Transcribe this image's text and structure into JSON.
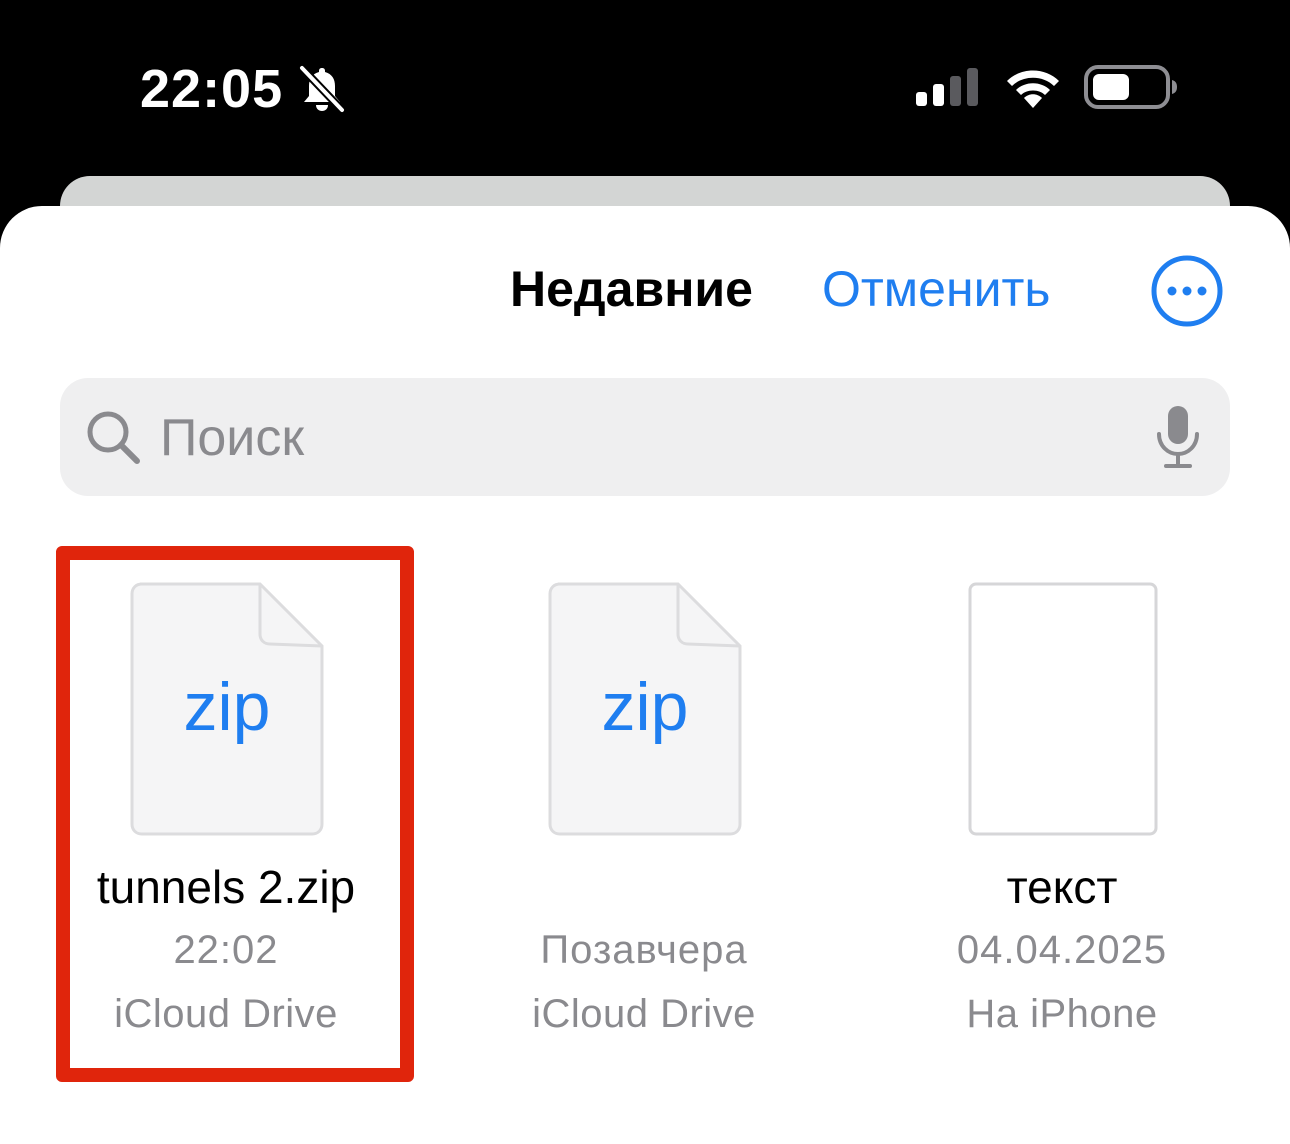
{
  "status_bar": {
    "time": "22:05",
    "icons": [
      "bell-slash-icon",
      "cellular-signal-icon",
      "wifi-icon",
      "battery-icon"
    ]
  },
  "header": {
    "title": "Недавние",
    "cancel_label": "Отменить",
    "more_icon": "ellipsis-circle-icon"
  },
  "search": {
    "placeholder": "Поиск",
    "value": "",
    "search_icon": "magnifying-glass-icon",
    "mic_icon": "microphone-icon"
  },
  "files": [
    {
      "name": "tunnels 2.zip",
      "date": "22:02",
      "location": "iCloud Drive",
      "thumbnail_label": "zip",
      "highlighted": true
    },
    {
      "name": "",
      "date": "Позавчера",
      "location": "iCloud Drive",
      "thumbnail_label": "zip",
      "highlighted": false
    },
    {
      "name": "текст",
      "date": "04.04.2025",
      "location": "На iPhone",
      "thumbnail_label": "",
      "highlighted": false
    }
  ],
  "colors": {
    "accent": "#1f7ef0",
    "highlight": "#e0250c",
    "secondary_text": "#8a8a8e",
    "search_bg": "#efeff0"
  }
}
